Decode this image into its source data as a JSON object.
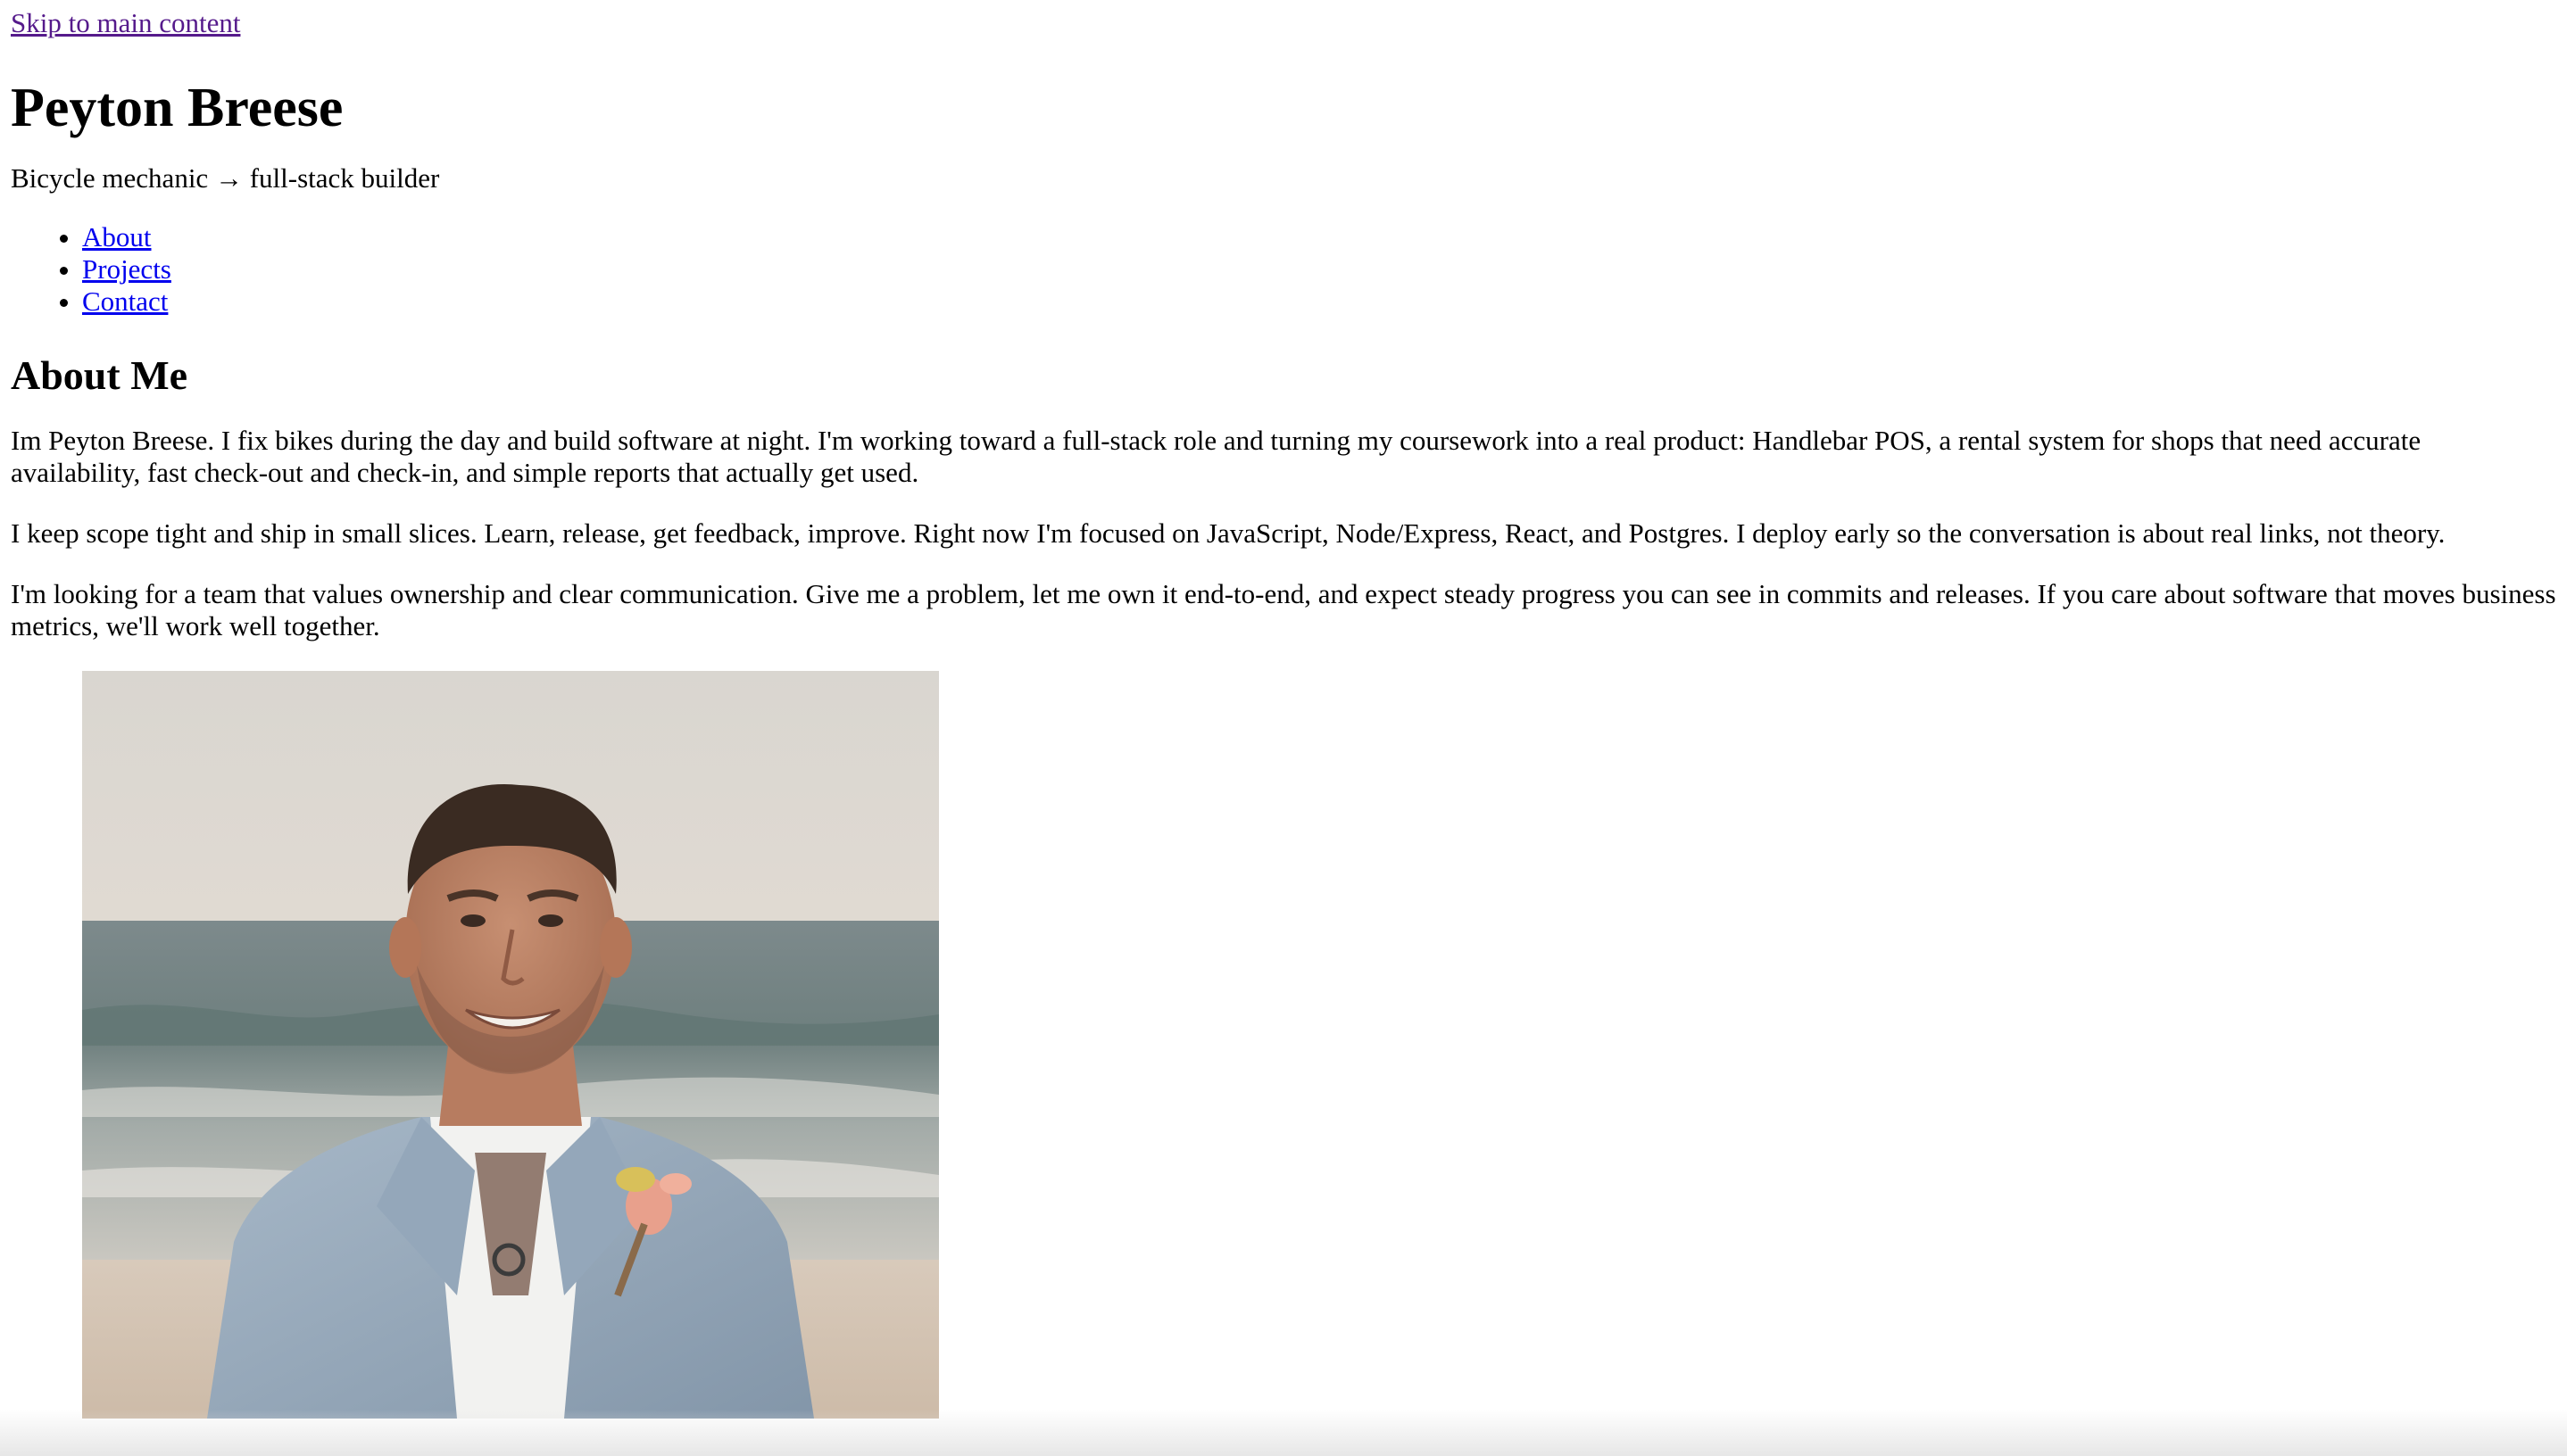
{
  "skip_link": "Skip to main content",
  "header": {
    "name": "Peyton Breese",
    "tagline": "Bicycle mechanic → full-stack builder"
  },
  "nav": {
    "items": [
      {
        "label": "About"
      },
      {
        "label": "Projects"
      },
      {
        "label": "Contact"
      }
    ]
  },
  "about": {
    "heading": "About Me",
    "paragraphs": [
      "Im Peyton Breese. I fix bikes during the day and build software at night. I'm working toward a full-stack role and turning my coursework into a real product: Handlebar POS, a rental system for shops that need accurate availability, fast check-out and check-in, and simple reports that actually get used.",
      "I keep scope tight and ship in small slices. Learn, release, get feedback, improve. Right now I'm focused on JavaScript, Node/Express, React, and Postgres. I deploy early so the conversation is about real links, not theory.",
      "I'm looking for a team that values ownership and clear communication. Give me a problem, let me own it end-to-end, and expect steady progress you can see in commits and releases. If you care about software that moves business metrics, we'll work well together."
    ],
    "photo_icon": "portrait-photo"
  },
  "colors": {
    "link": "#0000ee",
    "visited_link": "#551a8b",
    "text": "#000000",
    "background": "#ffffff"
  }
}
